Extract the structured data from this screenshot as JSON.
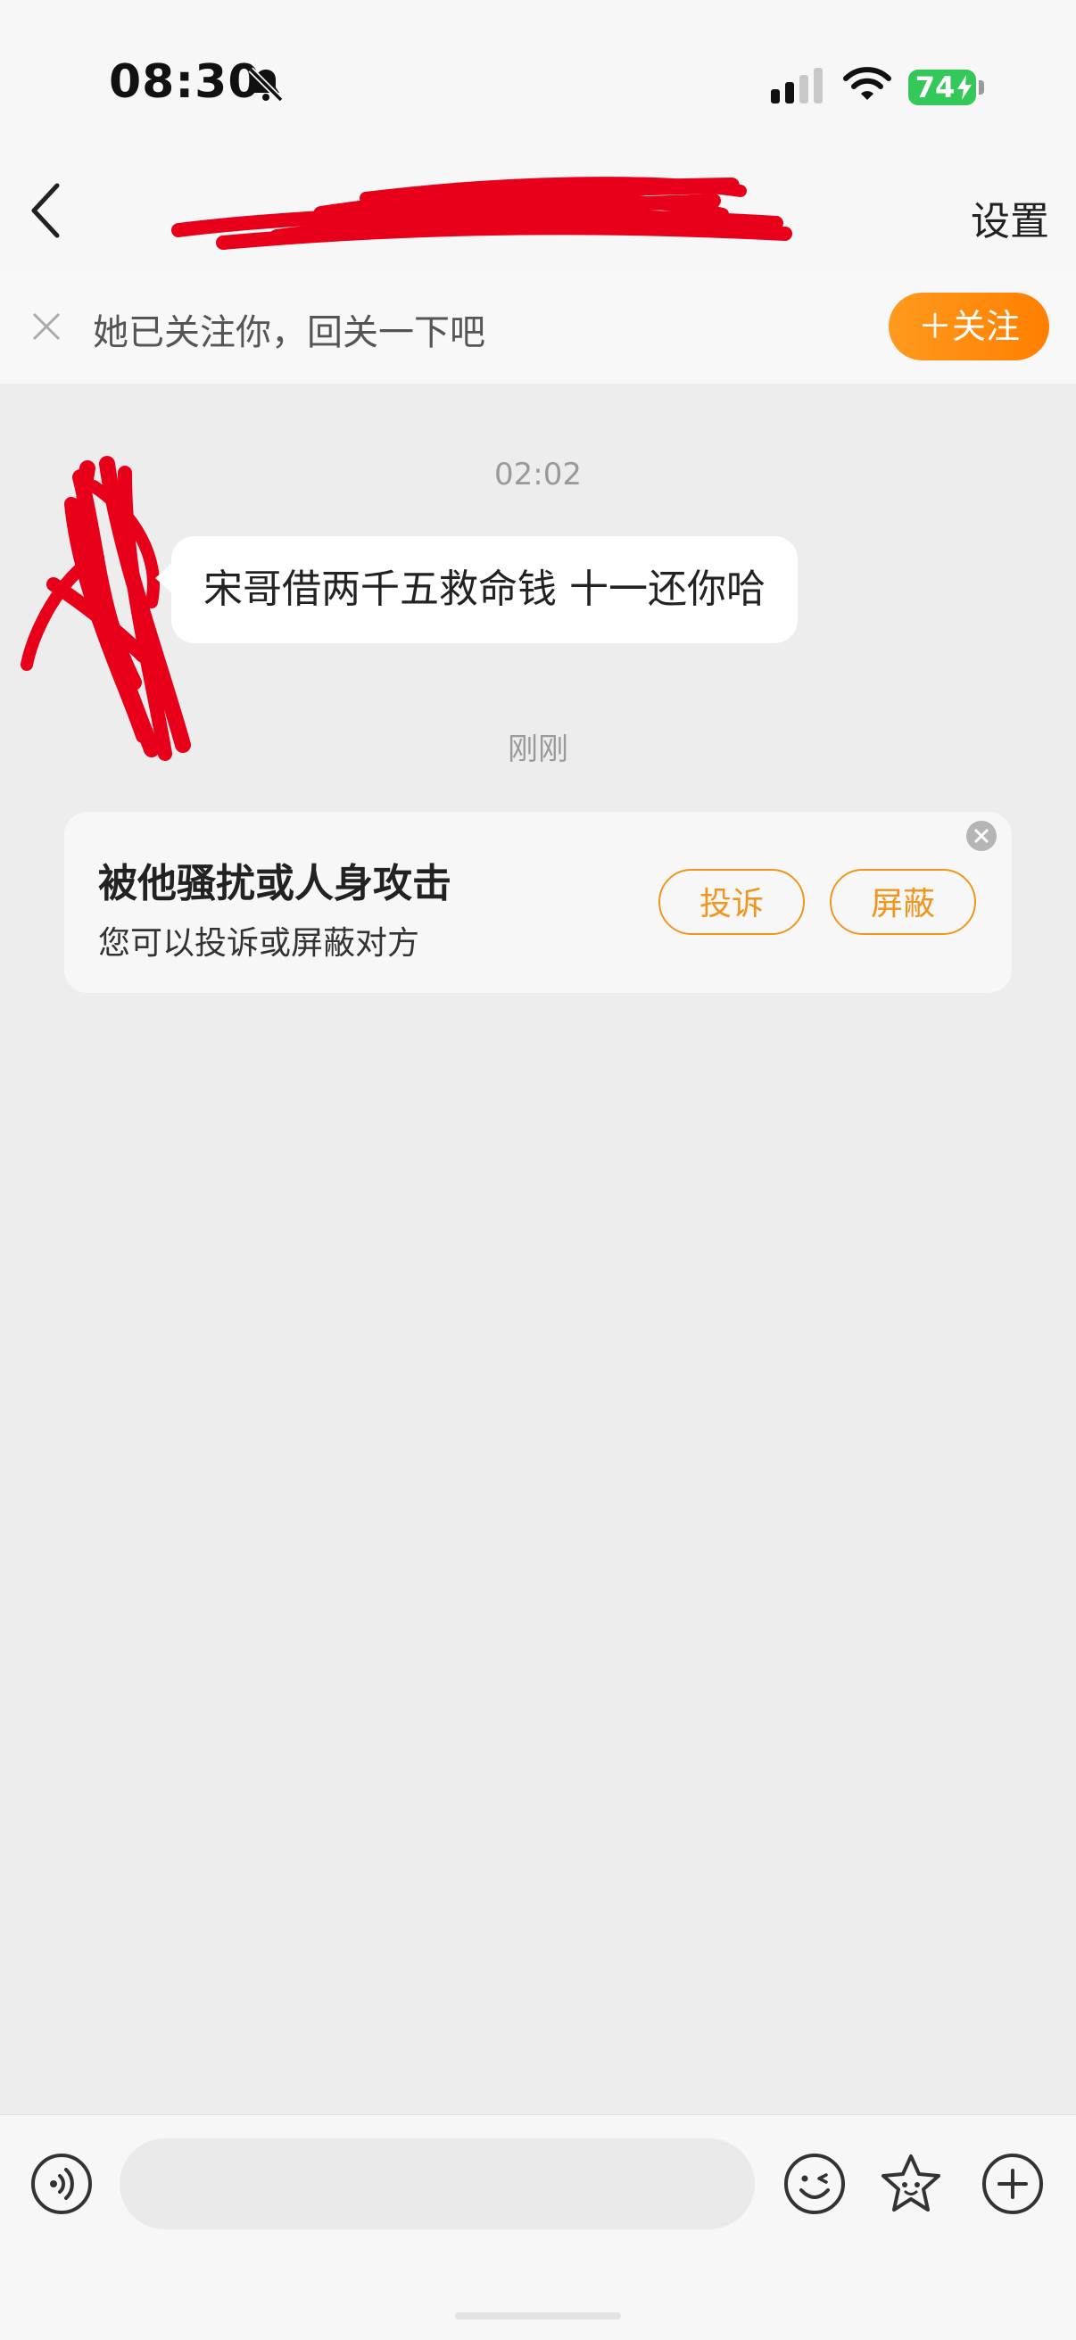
{
  "status_bar": {
    "time": "08:30",
    "battery_level": "74",
    "mute_icon": "bell-slash-icon",
    "signal_icon": "cellular-signal-icon",
    "wifi_icon": "wifi-icon",
    "battery_color": "#34c759"
  },
  "nav": {
    "back_icon": "chevron-left-icon",
    "title": "",
    "settings_label": "设置"
  },
  "follow_banner": {
    "close_icon": "close-icon",
    "text": "她已关注你，回关一下吧",
    "follow_button_label": "＋关注",
    "accent_color": "#ff8a00"
  },
  "conversation": {
    "timestamps": [
      "02:02",
      "刚刚"
    ],
    "messages": [
      {
        "sender": "other",
        "text": "宋哥借两千五救命钱 十一还你哈"
      }
    ]
  },
  "safety_card": {
    "title": "被他骚扰或人身攻击",
    "subtitle": "您可以投诉或屏蔽对方",
    "report_label": "投诉",
    "block_label": "屏蔽",
    "close_icon": "close-circle-icon"
  },
  "input_bar": {
    "voice_icon": "voice-icon",
    "input_value": "",
    "input_placeholder": "",
    "emoji_icon": "smile-emoji-icon",
    "sticker_icon": "star-sticker-icon",
    "plus_icon": "plus-circle-icon"
  }
}
